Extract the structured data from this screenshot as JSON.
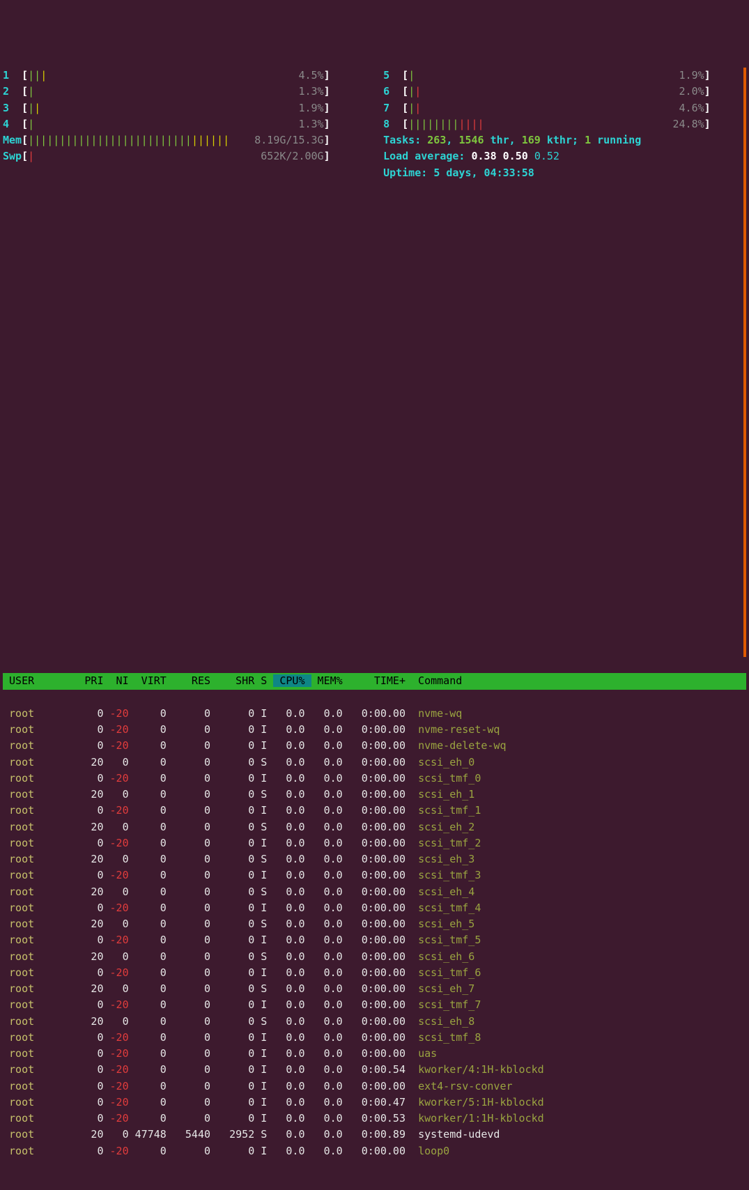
{
  "cpus_left": [
    {
      "n": "1",
      "bars_g": "||",
      "bars_y": "|",
      "pct": "4.5%"
    },
    {
      "n": "2",
      "bars_g": "|",
      "bars_y": "",
      "pct": "1.3%"
    },
    {
      "n": "3",
      "bars_g": "|",
      "bars_y": "|",
      "pct": "1.9%"
    },
    {
      "n": "4",
      "bars_g": "|",
      "bars_y": "",
      "pct": "1.3%"
    }
  ],
  "cpus_right": [
    {
      "n": "5",
      "bars_g": "|",
      "bars_y": "",
      "pct": "1.9%"
    },
    {
      "n": "6",
      "bars_g": "|",
      "bars_y": "",
      "bars_r": "|",
      "pct": "2.0%"
    },
    {
      "n": "7",
      "bars_g": "|",
      "bars_y": "",
      "bars_r": "|",
      "pct": "4.6%"
    },
    {
      "n": "8",
      "bars_g": "||||||||",
      "bars_y": "",
      "bars_r": "||||",
      "pct": "24.8%"
    }
  ],
  "mem": {
    "label": "Mem",
    "used": "8.19G",
    "total": "15.3G",
    "bars_g": "||||||||||||||||||||||||||",
    "bars_y": "||||||"
  },
  "swp": {
    "label": "Swp",
    "used": "652K",
    "total": "2.00G",
    "bars_r": "|"
  },
  "tasks": {
    "label": "Tasks:",
    "procs": "263",
    "sep1": ",",
    "thr": "1546",
    "thr_lbl": "thr,",
    "kthr": "169",
    "kthr_lbl": "kthr;",
    "run": "1",
    "run_lbl": "running"
  },
  "load": {
    "label": "Load average:",
    "l1": "0.38",
    "l2": "0.50",
    "l3": "0.52"
  },
  "uptime": {
    "label": "Uptime:",
    "val": "5 days, 04:33:58"
  },
  "header": {
    "user": "USER",
    "pri": "PRI",
    "ni": "NI",
    "virt": "VIRT",
    "res": "RES",
    "shr": "SHR",
    "s": "S",
    "cpu": "CPU%",
    "mem": "MEM%",
    "time": "TIME+",
    "cmd": "Command"
  },
  "procs": [
    {
      "user": "root",
      "pri": "0",
      "ni": "-20",
      "virt": "0",
      "res": "0",
      "shr": "0",
      "s": "I",
      "cpu": "0.0",
      "mem": "0.0",
      "time": "0:00.00",
      "cmd": "nvme-wq",
      "cw": 0
    },
    {
      "user": "root",
      "pri": "0",
      "ni": "-20",
      "virt": "0",
      "res": "0",
      "shr": "0",
      "s": "I",
      "cpu": "0.0",
      "mem": "0.0",
      "time": "0:00.00",
      "cmd": "nvme-reset-wq",
      "cw": 0
    },
    {
      "user": "root",
      "pri": "0",
      "ni": "-20",
      "virt": "0",
      "res": "0",
      "shr": "0",
      "s": "I",
      "cpu": "0.0",
      "mem": "0.0",
      "time": "0:00.00",
      "cmd": "nvme-delete-wq",
      "cw": 0
    },
    {
      "user": "root",
      "pri": "20",
      "ni": "0",
      "virt": "0",
      "res": "0",
      "shr": "0",
      "s": "S",
      "cpu": "0.0",
      "mem": "0.0",
      "time": "0:00.00",
      "cmd": "scsi_eh_0",
      "cw": 0
    },
    {
      "user": "root",
      "pri": "0",
      "ni": "-20",
      "virt": "0",
      "res": "0",
      "shr": "0",
      "s": "I",
      "cpu": "0.0",
      "mem": "0.0",
      "time": "0:00.00",
      "cmd": "scsi_tmf_0",
      "cw": 0
    },
    {
      "user": "root",
      "pri": "20",
      "ni": "0",
      "virt": "0",
      "res": "0",
      "shr": "0",
      "s": "S",
      "cpu": "0.0",
      "mem": "0.0",
      "time": "0:00.00",
      "cmd": "scsi_eh_1",
      "cw": 0
    },
    {
      "user": "root",
      "pri": "0",
      "ni": "-20",
      "virt": "0",
      "res": "0",
      "shr": "0",
      "s": "I",
      "cpu": "0.0",
      "mem": "0.0",
      "time": "0:00.00",
      "cmd": "scsi_tmf_1",
      "cw": 0
    },
    {
      "user": "root",
      "pri": "20",
      "ni": "0",
      "virt": "0",
      "res": "0",
      "shr": "0",
      "s": "S",
      "cpu": "0.0",
      "mem": "0.0",
      "time": "0:00.00",
      "cmd": "scsi_eh_2",
      "cw": 0
    },
    {
      "user": "root",
      "pri": "0",
      "ni": "-20",
      "virt": "0",
      "res": "0",
      "shr": "0",
      "s": "I",
      "cpu": "0.0",
      "mem": "0.0",
      "time": "0:00.00",
      "cmd": "scsi_tmf_2",
      "cw": 0
    },
    {
      "user": "root",
      "pri": "20",
      "ni": "0",
      "virt": "0",
      "res": "0",
      "shr": "0",
      "s": "S",
      "cpu": "0.0",
      "mem": "0.0",
      "time": "0:00.00",
      "cmd": "scsi_eh_3",
      "cw": 0
    },
    {
      "user": "root",
      "pri": "0",
      "ni": "-20",
      "virt": "0",
      "res": "0",
      "shr": "0",
      "s": "I",
      "cpu": "0.0",
      "mem": "0.0",
      "time": "0:00.00",
      "cmd": "scsi_tmf_3",
      "cw": 0
    },
    {
      "user": "root",
      "pri": "20",
      "ni": "0",
      "virt": "0",
      "res": "0",
      "shr": "0",
      "s": "S",
      "cpu": "0.0",
      "mem": "0.0",
      "time": "0:00.00",
      "cmd": "scsi_eh_4",
      "cw": 0
    },
    {
      "user": "root",
      "pri": "0",
      "ni": "-20",
      "virt": "0",
      "res": "0",
      "shr": "0",
      "s": "I",
      "cpu": "0.0",
      "mem": "0.0",
      "time": "0:00.00",
      "cmd": "scsi_tmf_4",
      "cw": 0
    },
    {
      "user": "root",
      "pri": "20",
      "ni": "0",
      "virt": "0",
      "res": "0",
      "shr": "0",
      "s": "S",
      "cpu": "0.0",
      "mem": "0.0",
      "time": "0:00.00",
      "cmd": "scsi_eh_5",
      "cw": 0
    },
    {
      "user": "root",
      "pri": "0",
      "ni": "-20",
      "virt": "0",
      "res": "0",
      "shr": "0",
      "s": "I",
      "cpu": "0.0",
      "mem": "0.0",
      "time": "0:00.00",
      "cmd": "scsi_tmf_5",
      "cw": 0
    },
    {
      "user": "root",
      "pri": "20",
      "ni": "0",
      "virt": "0",
      "res": "0",
      "shr": "0",
      "s": "S",
      "cpu": "0.0",
      "mem": "0.0",
      "time": "0:00.00",
      "cmd": "scsi_eh_6",
      "cw": 0
    },
    {
      "user": "root",
      "pri": "0",
      "ni": "-20",
      "virt": "0",
      "res": "0",
      "shr": "0",
      "s": "I",
      "cpu": "0.0",
      "mem": "0.0",
      "time": "0:00.00",
      "cmd": "scsi_tmf_6",
      "cw": 0
    },
    {
      "user": "root",
      "pri": "20",
      "ni": "0",
      "virt": "0",
      "res": "0",
      "shr": "0",
      "s": "S",
      "cpu": "0.0",
      "mem": "0.0",
      "time": "0:00.00",
      "cmd": "scsi_eh_7",
      "cw": 0
    },
    {
      "user": "root",
      "pri": "0",
      "ni": "-20",
      "virt": "0",
      "res": "0",
      "shr": "0",
      "s": "I",
      "cpu": "0.0",
      "mem": "0.0",
      "time": "0:00.00",
      "cmd": "scsi_tmf_7",
      "cw": 0
    },
    {
      "user": "root",
      "pri": "20",
      "ni": "0",
      "virt": "0",
      "res": "0",
      "shr": "0",
      "s": "S",
      "cpu": "0.0",
      "mem": "0.0",
      "time": "0:00.00",
      "cmd": "scsi_eh_8",
      "cw": 0
    },
    {
      "user": "root",
      "pri": "0",
      "ni": "-20",
      "virt": "0",
      "res": "0",
      "shr": "0",
      "s": "I",
      "cpu": "0.0",
      "mem": "0.0",
      "time": "0:00.00",
      "cmd": "scsi_tmf_8",
      "cw": 0
    },
    {
      "user": "root",
      "pri": "0",
      "ni": "-20",
      "virt": "0",
      "res": "0",
      "shr": "0",
      "s": "I",
      "cpu": "0.0",
      "mem": "0.0",
      "time": "0:00.00",
      "cmd": "uas",
      "cw": 0
    },
    {
      "user": "root",
      "pri": "0",
      "ni": "-20",
      "virt": "0",
      "res": "0",
      "shr": "0",
      "s": "I",
      "cpu": "0.0",
      "mem": "0.0",
      "time": "0:00.54",
      "cmd": "kworker/4:1H-kblockd",
      "cw": 0
    },
    {
      "user": "root",
      "pri": "0",
      "ni": "-20",
      "virt": "0",
      "res": "0",
      "shr": "0",
      "s": "I",
      "cpu": "0.0",
      "mem": "0.0",
      "time": "0:00.00",
      "cmd": "ext4-rsv-conver",
      "cw": 0
    },
    {
      "user": "root",
      "pri": "0",
      "ni": "-20",
      "virt": "0",
      "res": "0",
      "shr": "0",
      "s": "I",
      "cpu": "0.0",
      "mem": "0.0",
      "time": "0:00.47",
      "cmd": "kworker/5:1H-kblockd",
      "cw": 0
    },
    {
      "user": "root",
      "pri": "0",
      "ni": "-20",
      "virt": "0",
      "res": "0",
      "shr": "0",
      "s": "I",
      "cpu": "0.0",
      "mem": "0.0",
      "time": "0:00.53",
      "cmd": "kworker/1:1H-kblockd",
      "cw": 0
    },
    {
      "user": "root",
      "pri": "20",
      "ni": "0",
      "virt": "47748",
      "res": "5440",
      "shr": "2952",
      "s": "S",
      "cpu": "0.0",
      "mem": "0.0",
      "time": "0:00.89",
      "cmd": "systemd-udevd",
      "cw": 1
    },
    {
      "user": "root",
      "pri": "0",
      "ni": "-20",
      "virt": "0",
      "res": "0",
      "shr": "0",
      "s": "I",
      "cpu": "0.0",
      "mem": "0.0",
      "time": "0:00.00",
      "cmd": "loop0",
      "cw": 0
    }
  ]
}
